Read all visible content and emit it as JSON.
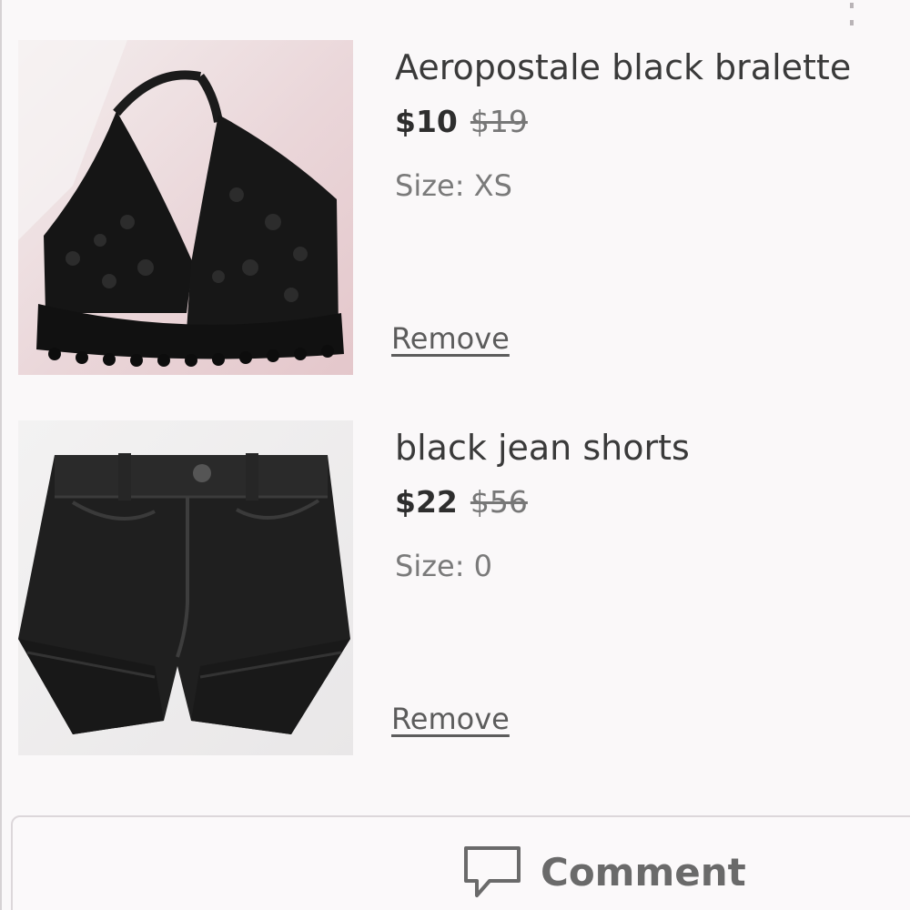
{
  "items": [
    {
      "title": "Aeropostale black bralette",
      "price": "$10",
      "original_price": "$19",
      "size": "Size: XS",
      "remove_label": "Remove",
      "image_icon": "black-lace-bralette"
    },
    {
      "title": "black jean shorts",
      "price": "$22",
      "original_price": "$56",
      "size": "Size: 0",
      "remove_label": "Remove",
      "image_icon": "black-denim-shorts"
    }
  ],
  "comment": {
    "label": "Comment",
    "icon": "speech-bubble-icon"
  },
  "colors": {
    "background": "#faf8f9",
    "text_primary": "#333333",
    "text_secondary": "#7a7a7a"
  }
}
